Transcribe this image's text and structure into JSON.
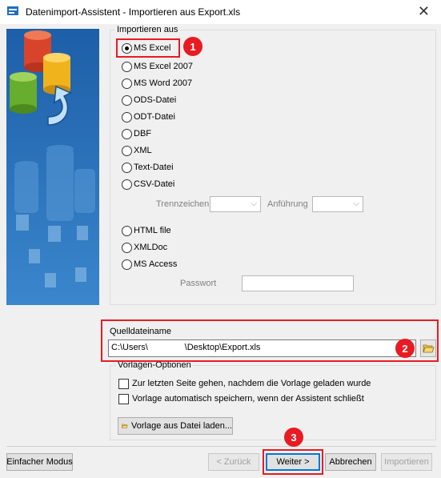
{
  "window": {
    "title": "Datenimport-Assistent -  Importieren aus  Export.xls",
    "close_label": "✕"
  },
  "import_from": {
    "label": "Importieren aus",
    "selected": "MS Excel",
    "options": [
      "MS Excel",
      "MS Excel 2007",
      "MS Word 2007",
      "ODS-Datei",
      "ODT-Datei",
      "DBF",
      "XML",
      "Text-Datei",
      "CSV-Datei",
      "HTML file",
      "XMLDoc",
      "MS Access"
    ],
    "separator_label": "Trennzeichen",
    "quote_label": "Anführung",
    "password_label": "Passwort"
  },
  "source": {
    "label": "Quelldateiname",
    "path": "C:\\Users\\               \\Desktop\\Export.xls"
  },
  "templates": {
    "label": "Vorlagen-Optionen",
    "option1": "Zur letzten Seite gehen, nachdem die Vorlage geladen wurde",
    "option2": "Vorlage automatisch speichern, wenn der Assistent schließt",
    "load_button": "Vorlage aus Datei laden..."
  },
  "footer": {
    "simple_mode": "Einfacher Modus",
    "back": "< Zurück",
    "next": "Weiter >",
    "cancel": "Abbrechen",
    "import": "Importieren"
  },
  "annotations": {
    "badge1": "1",
    "badge2": "2",
    "badge3": "3"
  },
  "colors": {
    "highlight": "#e81b23",
    "banner": "#2c6fb4",
    "default_button_border": "#0078d7"
  }
}
